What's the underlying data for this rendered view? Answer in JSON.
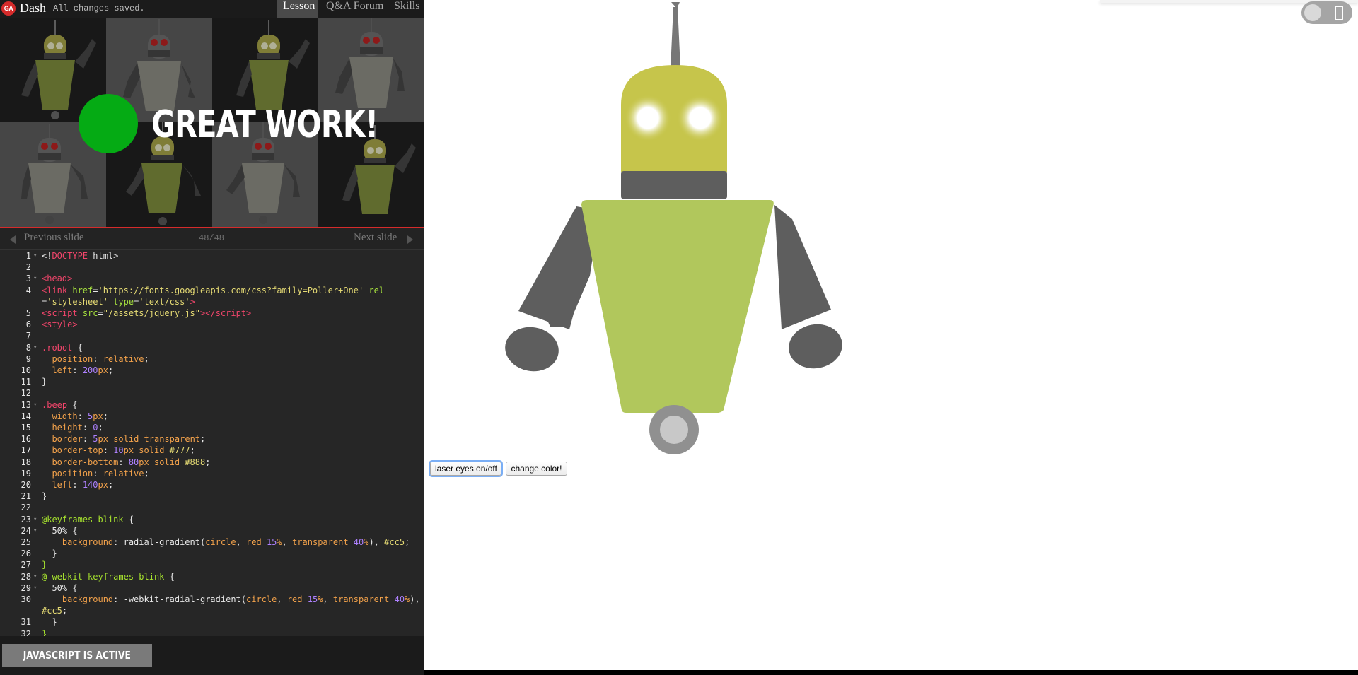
{
  "header": {
    "logo_text": "GA",
    "app_name": "Dash",
    "save_status": "All changes saved.",
    "tabs": [
      {
        "label": "Lesson",
        "active": true
      },
      {
        "label": "Q&A Forum",
        "active": false
      },
      {
        "label": "Skills",
        "active": false
      }
    ]
  },
  "slide": {
    "headline": "GREAT WORK!",
    "accent_color": "#05ab14",
    "rule_color": "#d52b2b"
  },
  "slide_nav": {
    "prev_label": "Previous slide",
    "next_label": "Next slide",
    "counter": "48/48"
  },
  "editor": {
    "lines": [
      {
        "n": "1",
        "fold": true,
        "html": "<span class='w'>&lt;!</span><span class='t'>DOCTYPE</span><span class='w'> html&gt;</span>"
      },
      {
        "n": "2",
        "fold": false,
        "html": ""
      },
      {
        "n": "3",
        "fold": true,
        "html": "<span class='t'>&lt;head&gt;</span>"
      },
      {
        "n": "4",
        "fold": false,
        "html": "<span class='t'>&lt;link</span> <span class='a'>href</span>=<span class='s'>'https://fonts.googleapis.com/css?family=Poller+One'</span> <span class='a'>rel</span>"
      },
      {
        "n": "",
        "fold": false,
        "html": "=<span class='s'>'stylesheet'</span> <span class='a'>type</span>=<span class='s'>'text/css'</span><span class='t'>&gt;</span>"
      },
      {
        "n": "5",
        "fold": false,
        "html": "<span class='t'>&lt;script</span> <span class='a'>src</span>=<span class='s'>\"/assets/jquery.js\"</span><span class='t'>&gt;&lt;/script&gt;</span>"
      },
      {
        "n": "6",
        "fold": false,
        "html": "<span class='t'>&lt;style&gt;</span>"
      },
      {
        "n": "7",
        "fold": false,
        "html": ""
      },
      {
        "n": "8",
        "fold": true,
        "html": "<span class='t'>.robot</span> {"
      },
      {
        "n": "9",
        "fold": false,
        "html": "  <span class='p'>position</span>: <span class='p'>relative</span>;"
      },
      {
        "n": "10",
        "fold": false,
        "html": "  <span class='p'>left</span>: <span class='n'>200</span><span class='p'>px</span>;"
      },
      {
        "n": "11",
        "fold": false,
        "html": "}"
      },
      {
        "n": "12",
        "fold": false,
        "html": ""
      },
      {
        "n": "13",
        "fold": true,
        "html": "<span class='t'>.beep</span> {"
      },
      {
        "n": "14",
        "fold": false,
        "html": "  <span class='p'>width</span>: <span class='n'>5</span><span class='p'>px</span>;"
      },
      {
        "n": "15",
        "fold": false,
        "html": "  <span class='p'>height</span>: <span class='n'>0</span>;"
      },
      {
        "n": "16",
        "fold": false,
        "html": "  <span class='p'>border</span>: <span class='n'>5</span><span class='p'>px</span> <span class='p'>solid</span> <span class='p'>transparent</span>;"
      },
      {
        "n": "17",
        "fold": false,
        "html": "  <span class='p'>border-top</span>: <span class='n'>10</span><span class='p'>px</span> <span class='p'>solid</span> <span class='s'>#777</span>;"
      },
      {
        "n": "18",
        "fold": false,
        "html": "  <span class='p'>border-bottom</span>: <span class='n'>80</span><span class='p'>px</span> <span class='p'>solid</span> <span class='s'>#888</span>;"
      },
      {
        "n": "19",
        "fold": false,
        "html": "  <span class='p'>position</span>: <span class='p'>relative</span>;"
      },
      {
        "n": "20",
        "fold": false,
        "html": "  <span class='p'>left</span>: <span class='n'>140</span><span class='p'>px</span>;"
      },
      {
        "n": "21",
        "fold": false,
        "html": "}"
      },
      {
        "n": "22",
        "fold": false,
        "html": ""
      },
      {
        "n": "23",
        "fold": true,
        "html": "<span class='k'>@keyframes blink</span> {"
      },
      {
        "n": "24",
        "fold": true,
        "html": "  <span class='w'>50%</span> {"
      },
      {
        "n": "25",
        "fold": false,
        "html": "    <span class='p'>background</span>: radial-gradient(<span class='p'>circle</span>, <span class='p'>red</span> <span class='n'>15</span><span class='p'>%</span>, <span class='p'>transparent</span> <span class='n'>40</span><span class='p'>%</span>), <span class='s'>#cc5</span>;"
      },
      {
        "n": "26",
        "fold": false,
        "html": "  }"
      },
      {
        "n": "27",
        "fold": false,
        "html": "<span class='k'>}</span>"
      },
      {
        "n": "28",
        "fold": true,
        "html": "<span class='k'>@-webkit-keyframes blink</span> {"
      },
      {
        "n": "29",
        "fold": true,
        "html": "  <span class='w'>50%</span> {"
      },
      {
        "n": "30",
        "fold": false,
        "html": "    <span class='p'>background</span>: -webkit-radial-gradient(<span class='p'>circle</span>, <span class='p'>red</span> <span class='n'>15</span><span class='p'>%</span>, <span class='p'>transparent</span> <span class='n'>40</span><span class='p'>%</span>),"
      },
      {
        "n": "",
        "fold": false,
        "html": "<span class='s'>#cc5</span>;"
      },
      {
        "n": "31",
        "fold": false,
        "html": "  }"
      },
      {
        "n": "32",
        "fold": false,
        "html": "<span class='k'>}</span>"
      }
    ]
  },
  "js_status": "JAVASCRIPT IS ACTIVE",
  "preview": {
    "buttons": {
      "laser": "laser eyes on/off",
      "color": "change color!"
    },
    "robot_colors": {
      "head": "#c6c54b",
      "body": "#b1c75c",
      "limbs": "#5e5e5e",
      "antenna": "#777777",
      "wheel_outer": "#909090",
      "wheel_inner": "#c8c8c8"
    }
  }
}
